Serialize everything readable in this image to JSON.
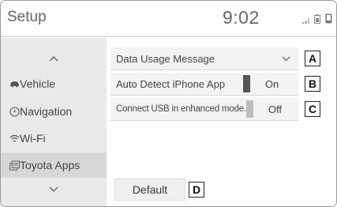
{
  "header": {
    "title": "Setup",
    "clock": "9:02"
  },
  "sidebar": {
    "items": [
      {
        "label": "Vehicle",
        "icon": "car-icon"
      },
      {
        "label": "Navigation",
        "icon": "navigation-compass-icon"
      },
      {
        "label": "Wi-Fi",
        "icon": "wifi-icon"
      },
      {
        "label": "Toyota Apps",
        "icon": "toyota-apps-icon",
        "active": true
      }
    ]
  },
  "settings": {
    "data_usage": {
      "label": "Data Usage Message",
      "callout": "A"
    },
    "auto_detect": {
      "label": "Auto Detect iPhone App",
      "value": "On",
      "callout": "B"
    },
    "usb_mode": {
      "label": "Connect USB in enhanced mode.",
      "value": "Off",
      "callout": "C"
    }
  },
  "default_button": {
    "label": "Default",
    "callout": "D"
  },
  "colors": {
    "switch_on": "#555555",
    "switch_off": "#bdbdbd",
    "sidebar_bg": "#e9e9e9"
  }
}
